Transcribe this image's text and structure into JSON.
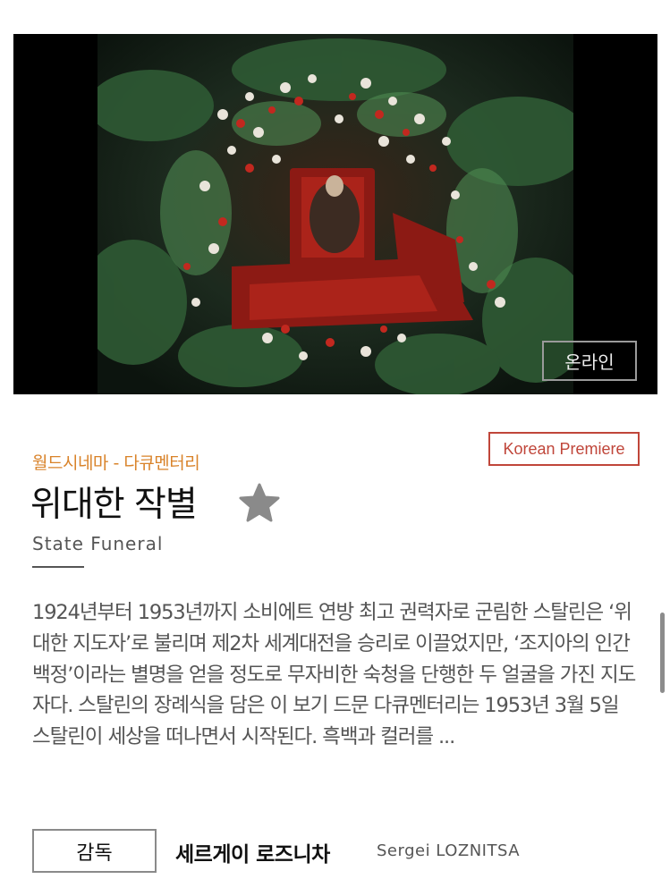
{
  "film": {
    "badge_online": "온라인",
    "premiere_label": "Korean Premiere",
    "category": "월드시네마 - 다큐멘터리",
    "title_ko": "위대한 작별",
    "title_en": "State Funeral",
    "description": "1924년부터 1953년까지 소비에트 연방 최고 권력자로 군림한 스탈린은 ‘위대한 지도자’로 불리며 제2차 세계대전을 승리로 이끌었지만, ‘조지아의 인간 백정’이라는 별명을 얻을 정도로 무자비한 숙청을 단행한 두 얼굴을 가진 지도자다. 스탈린의 장례식을 담은 이 보기 드문 다큐멘터리는 1953년 3월 5일 스탈린이 세상을 떠나면서 시작된다. 흑백과 컬러를 ...",
    "director_label": "감독",
    "director_name_ko": "세르게이 로즈니차",
    "director_name_en": "Sergei LOZNITSA"
  },
  "colors": {
    "accent_orange": "#d9832a",
    "premiere_red": "#c0463a",
    "favorite_star": "#8a8a8a"
  },
  "icons": {
    "favorite": "star-icon"
  }
}
